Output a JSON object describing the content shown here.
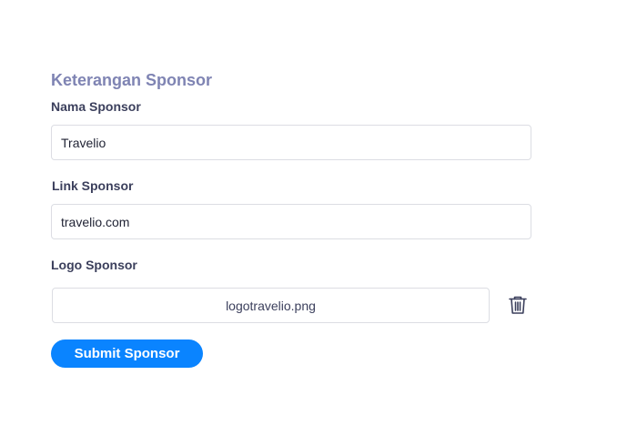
{
  "section": {
    "title": "Keterangan Sponsor"
  },
  "fields": {
    "name": {
      "label": "Nama Sponsor",
      "value": "Travelio"
    },
    "link": {
      "label": "Link Sponsor",
      "value": "travelio.com"
    },
    "logo": {
      "label": "Logo Sponsor",
      "filename": "logotravelio.png",
      "delete_icon": "trash-icon"
    }
  },
  "submit": {
    "label": "Submit Sponsor"
  },
  "colors": {
    "title": "#7f84b3",
    "label": "#3b3f5c",
    "button": "#0a84ff",
    "border": "#dcdde3"
  }
}
